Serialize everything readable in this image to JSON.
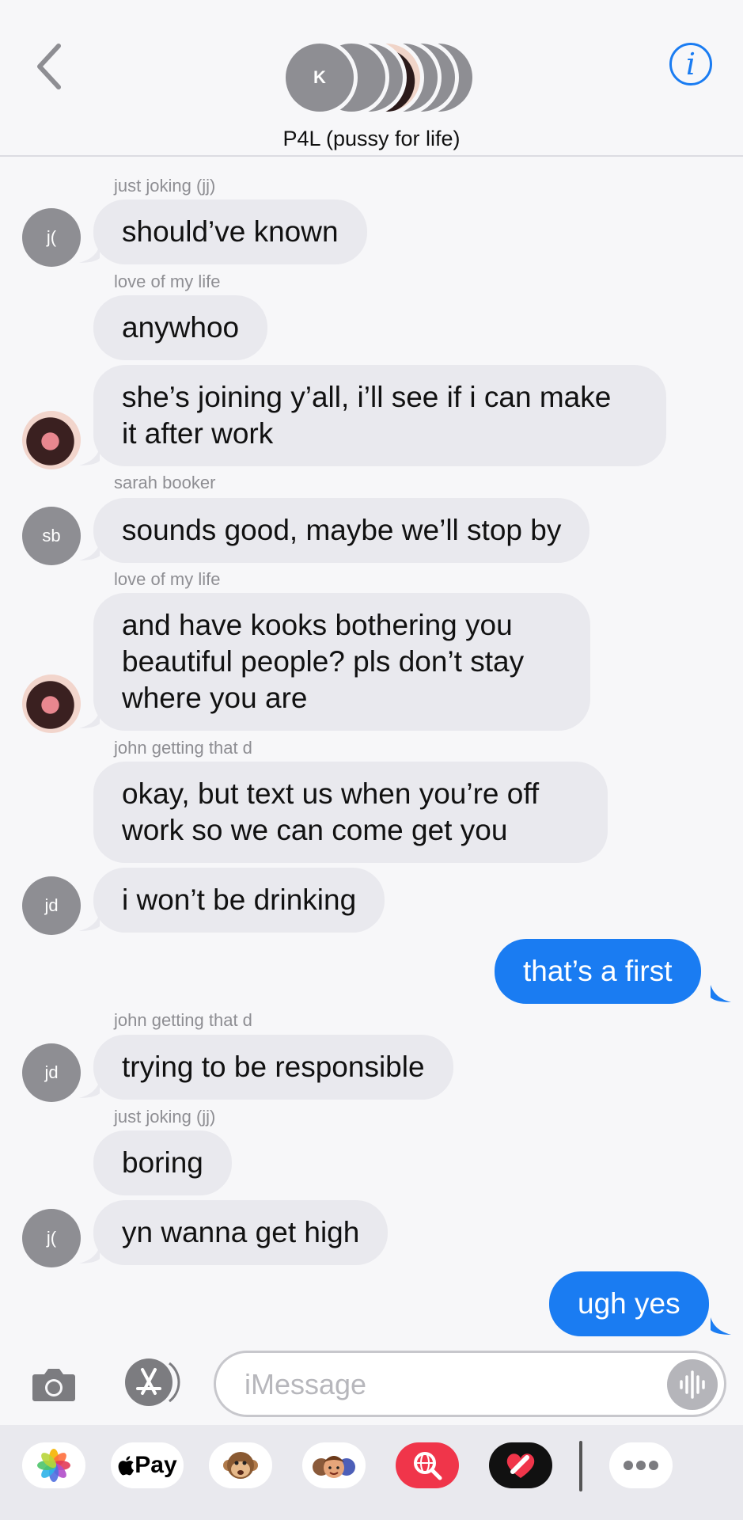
{
  "header": {
    "group_name": "P4L (pussy for life)",
    "stack_initial": "K",
    "info_glyph": "i"
  },
  "messages": [
    {
      "sender": "just joking (jj)",
      "text": "should’ve known",
      "avatar": "j("
    },
    {
      "sender": "love of my life",
      "text": "anywhoo"
    },
    {
      "text": "she’s joining y’all, i’ll see if i can make\nit after work"
    },
    {
      "sender": "sarah booker",
      "text": "sounds good, maybe we’ll stop by",
      "avatar": "sb"
    },
    {
      "sender": "love of my life",
      "text": "and have kooks bothering you\nbeautiful people? pls don’t stay\nwhere you are"
    },
    {
      "sender": "john getting that d",
      "text": "okay, but text us when you’re off\nwork so we can come get you"
    },
    {
      "text": "i won’t be drinking",
      "avatar": "jd"
    },
    {
      "text": "that’s a first",
      "from_me": true
    },
    {
      "sender": "john getting that d",
      "text": "trying to be responsible",
      "avatar": "jd"
    },
    {
      "sender": "just joking (jj)",
      "text": "boring"
    },
    {
      "text": "yn wanna get high",
      "avatar": "j("
    },
    {
      "text": "ugh yes",
      "from_me": true
    }
  ],
  "composer": {
    "placeholder": "iMessage"
  },
  "apps": {
    "apple_pay_label": "Pay"
  },
  "colors": {
    "sent_bubble": "#1a7cf2",
    "received_bubble": "#e9e9ee",
    "accent": "#1a7cf2"
  },
  "icons": [
    "back-chevron-icon",
    "info-icon",
    "camera-icon",
    "app-store-icon",
    "audio-waveform-icon",
    "photos-icon",
    "apple-pay-icon",
    "animoji-monkey-icon",
    "memoji-icon",
    "web-search-icon",
    "digital-touch-heart-icon",
    "more-icon"
  ]
}
